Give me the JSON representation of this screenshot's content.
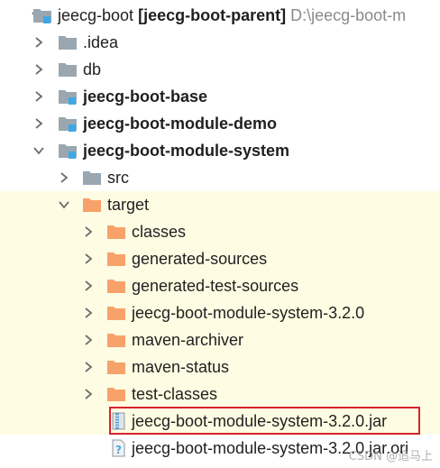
{
  "colors": {
    "gray_folder": "#9aa7b0",
    "orange_folder": "#f7a26a",
    "module_marker": "#3ea8e6",
    "excluded_bg": "#fefde3",
    "highlight": "#d6232c"
  },
  "tree": {
    "root": {
      "name": "jeecg-boot",
      "module": "[jeecg-boot-parent]",
      "path": "D:\\jeecg-boot-m",
      "icon": "module-folder-icon"
    },
    "rows": [
      {
        "label": "jeecg-boot",
        "bold": false,
        "expanded": true,
        "icon": "module-folder-icon"
      },
      {
        "label": ".idea",
        "bold": false,
        "expanded": false,
        "icon": "folder-icon"
      },
      {
        "label": "db",
        "bold": false,
        "expanded": false,
        "icon": "folder-icon"
      },
      {
        "label": "jeecg-boot-base",
        "bold": true,
        "expanded": false,
        "icon": "module-folder-icon"
      },
      {
        "label": "jeecg-boot-module-demo",
        "bold": true,
        "expanded": false,
        "icon": "module-folder-icon"
      },
      {
        "label": "jeecg-boot-module-system",
        "bold": true,
        "expanded": true,
        "icon": "module-folder-icon"
      },
      {
        "label": "src",
        "bold": false,
        "expanded": false,
        "icon": "folder-icon"
      },
      {
        "label": "target",
        "bold": false,
        "expanded": true,
        "icon": "excluded-folder-icon"
      },
      {
        "label": "classes",
        "bold": false,
        "expanded": false,
        "icon": "excluded-folder-icon"
      },
      {
        "label": "generated-sources",
        "bold": false,
        "expanded": false,
        "icon": "excluded-folder-icon"
      },
      {
        "label": "generated-test-sources",
        "bold": false,
        "expanded": false,
        "icon": "excluded-folder-icon"
      },
      {
        "label": "jeecg-boot-module-system-3.2.0",
        "bold": false,
        "expanded": false,
        "icon": "excluded-folder-icon"
      },
      {
        "label": "maven-archiver",
        "bold": false,
        "expanded": false,
        "icon": "excluded-folder-icon"
      },
      {
        "label": "maven-status",
        "bold": false,
        "expanded": false,
        "icon": "excluded-folder-icon"
      },
      {
        "label": "test-classes",
        "bold": false,
        "expanded": false,
        "icon": "excluded-folder-icon"
      },
      {
        "label": "jeecg-boot-module-system-3.2.0.jar",
        "bold": false,
        "expanded": null,
        "icon": "jar-file-icon"
      },
      {
        "label": "jeecg-boot-module-system-3.2.0.jar.ori",
        "bold": false,
        "expanded": null,
        "icon": "unknown-file-icon"
      }
    ]
  },
  "watermark": "CSDN @追马上"
}
